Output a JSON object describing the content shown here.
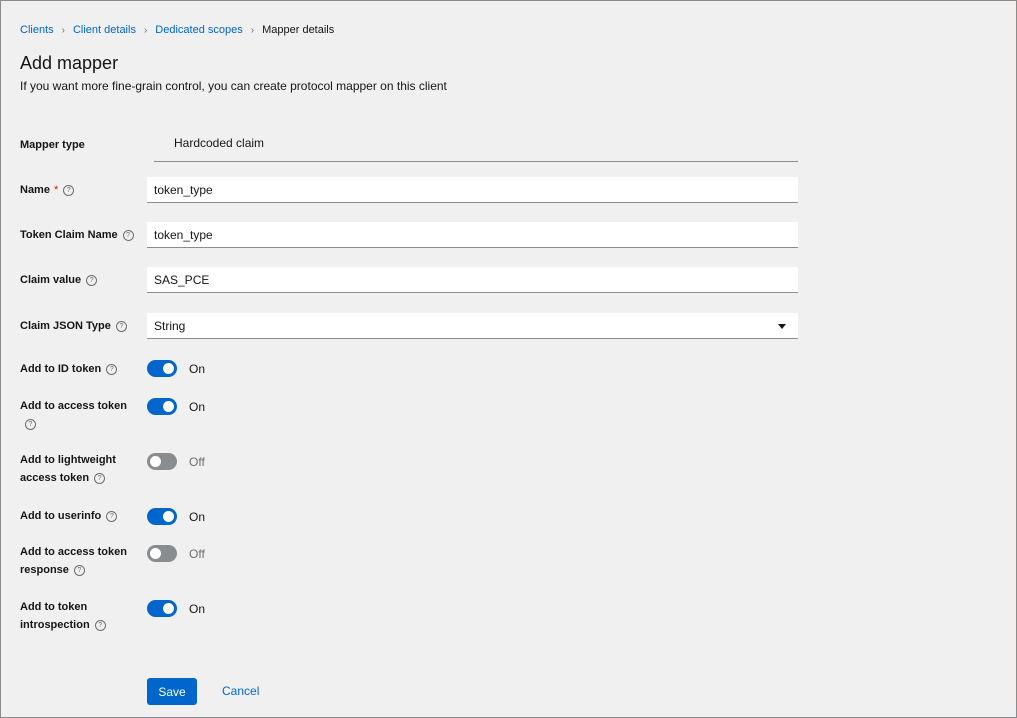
{
  "breadcrumb": {
    "items": [
      "Clients",
      "Client details",
      "Dedicated scopes"
    ],
    "current": "Mapper details",
    "separator": "›"
  },
  "header": {
    "title": "Add mapper",
    "subtitle": "If you want more fine-grain control, you can create protocol mapper on this client"
  },
  "form": {
    "mapper_type": {
      "label": "Mapper type",
      "value": "Hardcoded claim"
    },
    "name": {
      "label": "Name",
      "required_mark": "*",
      "value": "token_type"
    },
    "token_claim_name": {
      "label": "Token Claim Name",
      "value": "token_type"
    },
    "claim_value": {
      "label": "Claim value",
      "value": "SAS_PCE"
    },
    "claim_json_type": {
      "label": "Claim JSON Type",
      "value": "String"
    },
    "toggles": [
      {
        "label": "Add to ID token",
        "state": true,
        "text": "On"
      },
      {
        "label": "Add to access token",
        "state": true,
        "text": "On"
      },
      {
        "label": "Add to lightweight access token",
        "state": false,
        "text": "Off"
      },
      {
        "label": "Add to userinfo",
        "state": true,
        "text": "On"
      },
      {
        "label": "Add to access token response",
        "state": false,
        "text": "Off"
      },
      {
        "label": "Add to token introspection",
        "state": true,
        "text": "On"
      }
    ],
    "help_glyph": "?"
  },
  "actions": {
    "save": "Save",
    "cancel": "Cancel"
  },
  "colors": {
    "accent": "#0066cc",
    "background": "#f0f0f0",
    "toggle_off": "#8a8d90",
    "required": "#c9190b"
  }
}
